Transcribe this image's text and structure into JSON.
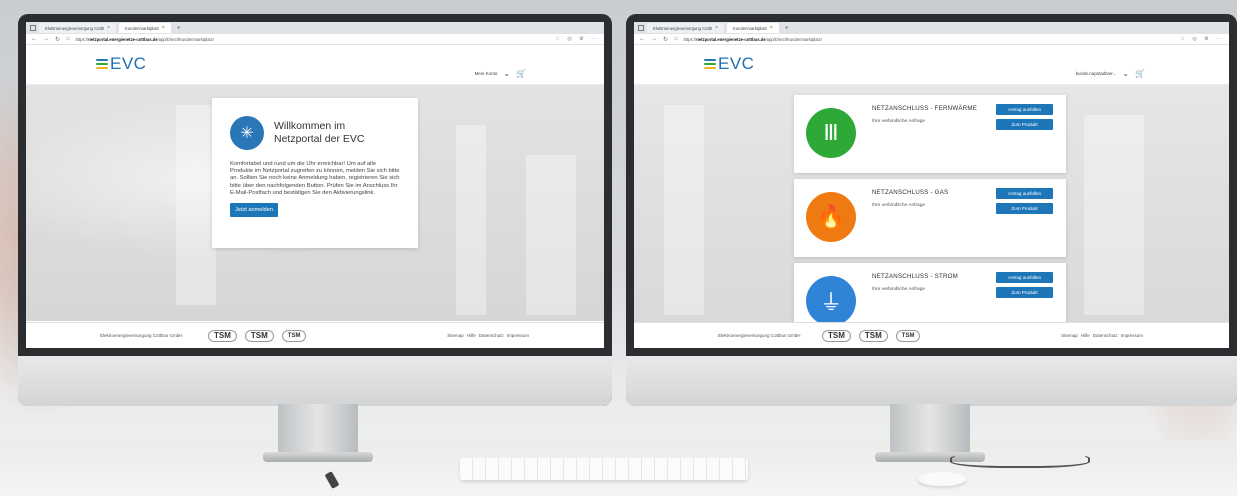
{
  "left_screen": {
    "tabs": [
      {
        "label": "Elektroenergieversorgung Cottb",
        "active": false
      },
      {
        "label": "Kundenmarktplatz",
        "active": true
      }
    ],
    "url_prefix": "https://",
    "url_domain": "netzportal.energienetze-cottbus.de",
    "url_path": "/app/Direct/Kundenmarktplatz/",
    "logo": "EVC",
    "account_label": "Mein Konto",
    "welcome": {
      "title_line1": "Willkommen im",
      "title_line2": "Netzportal der EVC",
      "text": "Komfortabel und rund um die Uhr erreichbar! Um auf alle Produkte im Netzportal zugreifen zu können, melden Sie sich bitte an. Sollten Sie noch keine Anmeldung haben, registrieren Sie sich bitte über den nachfolgenden Button. Prüfen Sie im Anschluss Ihr E-Mail-Postfach und bestätigen Sie den Aktivierungslink.",
      "button": "Jetzt anmelden"
    },
    "footer": {
      "company": "Elektroenergieversorgung Cottbus GmbH",
      "logos": [
        "TSM",
        "TSM",
        "TSM"
      ],
      "links": [
        "Sitemap",
        "Hilfe",
        "Datenschutz",
        "Impressum"
      ]
    }
  },
  "right_screen": {
    "tabs": [
      {
        "label": "Elektroenergieversorgung Cottb",
        "active": false
      },
      {
        "label": "Kundenmarktplatz",
        "active": true
      }
    ],
    "url_prefix": "https://",
    "url_domain": "netzportal.energienetze-cottbus.de",
    "url_path": "/app/Direct/Kundenmarktplatz/",
    "logo": "EVC",
    "account_label": "kunde.napstadtver...",
    "products": [
      {
        "title": "NETZANSCHLUSS - FERNWÄRME",
        "subtitle": "Ihre verbindliche Anfrage",
        "btn_primary": "Antrag ausfüllen",
        "btn_secondary": "Zum Produkt",
        "color": "#2ea836",
        "icon": "radiator-icon",
        "glyph": "Ⅲ"
      },
      {
        "title": "NETZANSCHLUSS - GAS",
        "subtitle": "Ihre verbindliche Anfrage",
        "btn_primary": "Antrag ausfüllen",
        "btn_secondary": "Zum Produkt",
        "color": "#f07a12",
        "icon": "flame-icon",
        "glyph": "🔥"
      },
      {
        "title": "NETZANSCHLUSS - STROM",
        "subtitle": "Ihre verbindliche Anfrage",
        "btn_primary": "Antrag ausfüllen",
        "btn_secondary": "Zum Produkt",
        "color": "#2f84d8",
        "icon": "plug-icon",
        "glyph": "⏚"
      }
    ],
    "footer": {
      "company": "Elektroenergieversorgung Cottbus GmbH",
      "logos": [
        "TSM",
        "TSM",
        "TSM"
      ],
      "links": [
        "Sitemap",
        "Hilfe",
        "Datenschutz",
        "Impressum"
      ]
    }
  },
  "colors": {
    "brand_blue": "#1d76b8",
    "logo_lines": [
      "#2a77b8",
      "#2ea836",
      "#f2b21a"
    ]
  }
}
